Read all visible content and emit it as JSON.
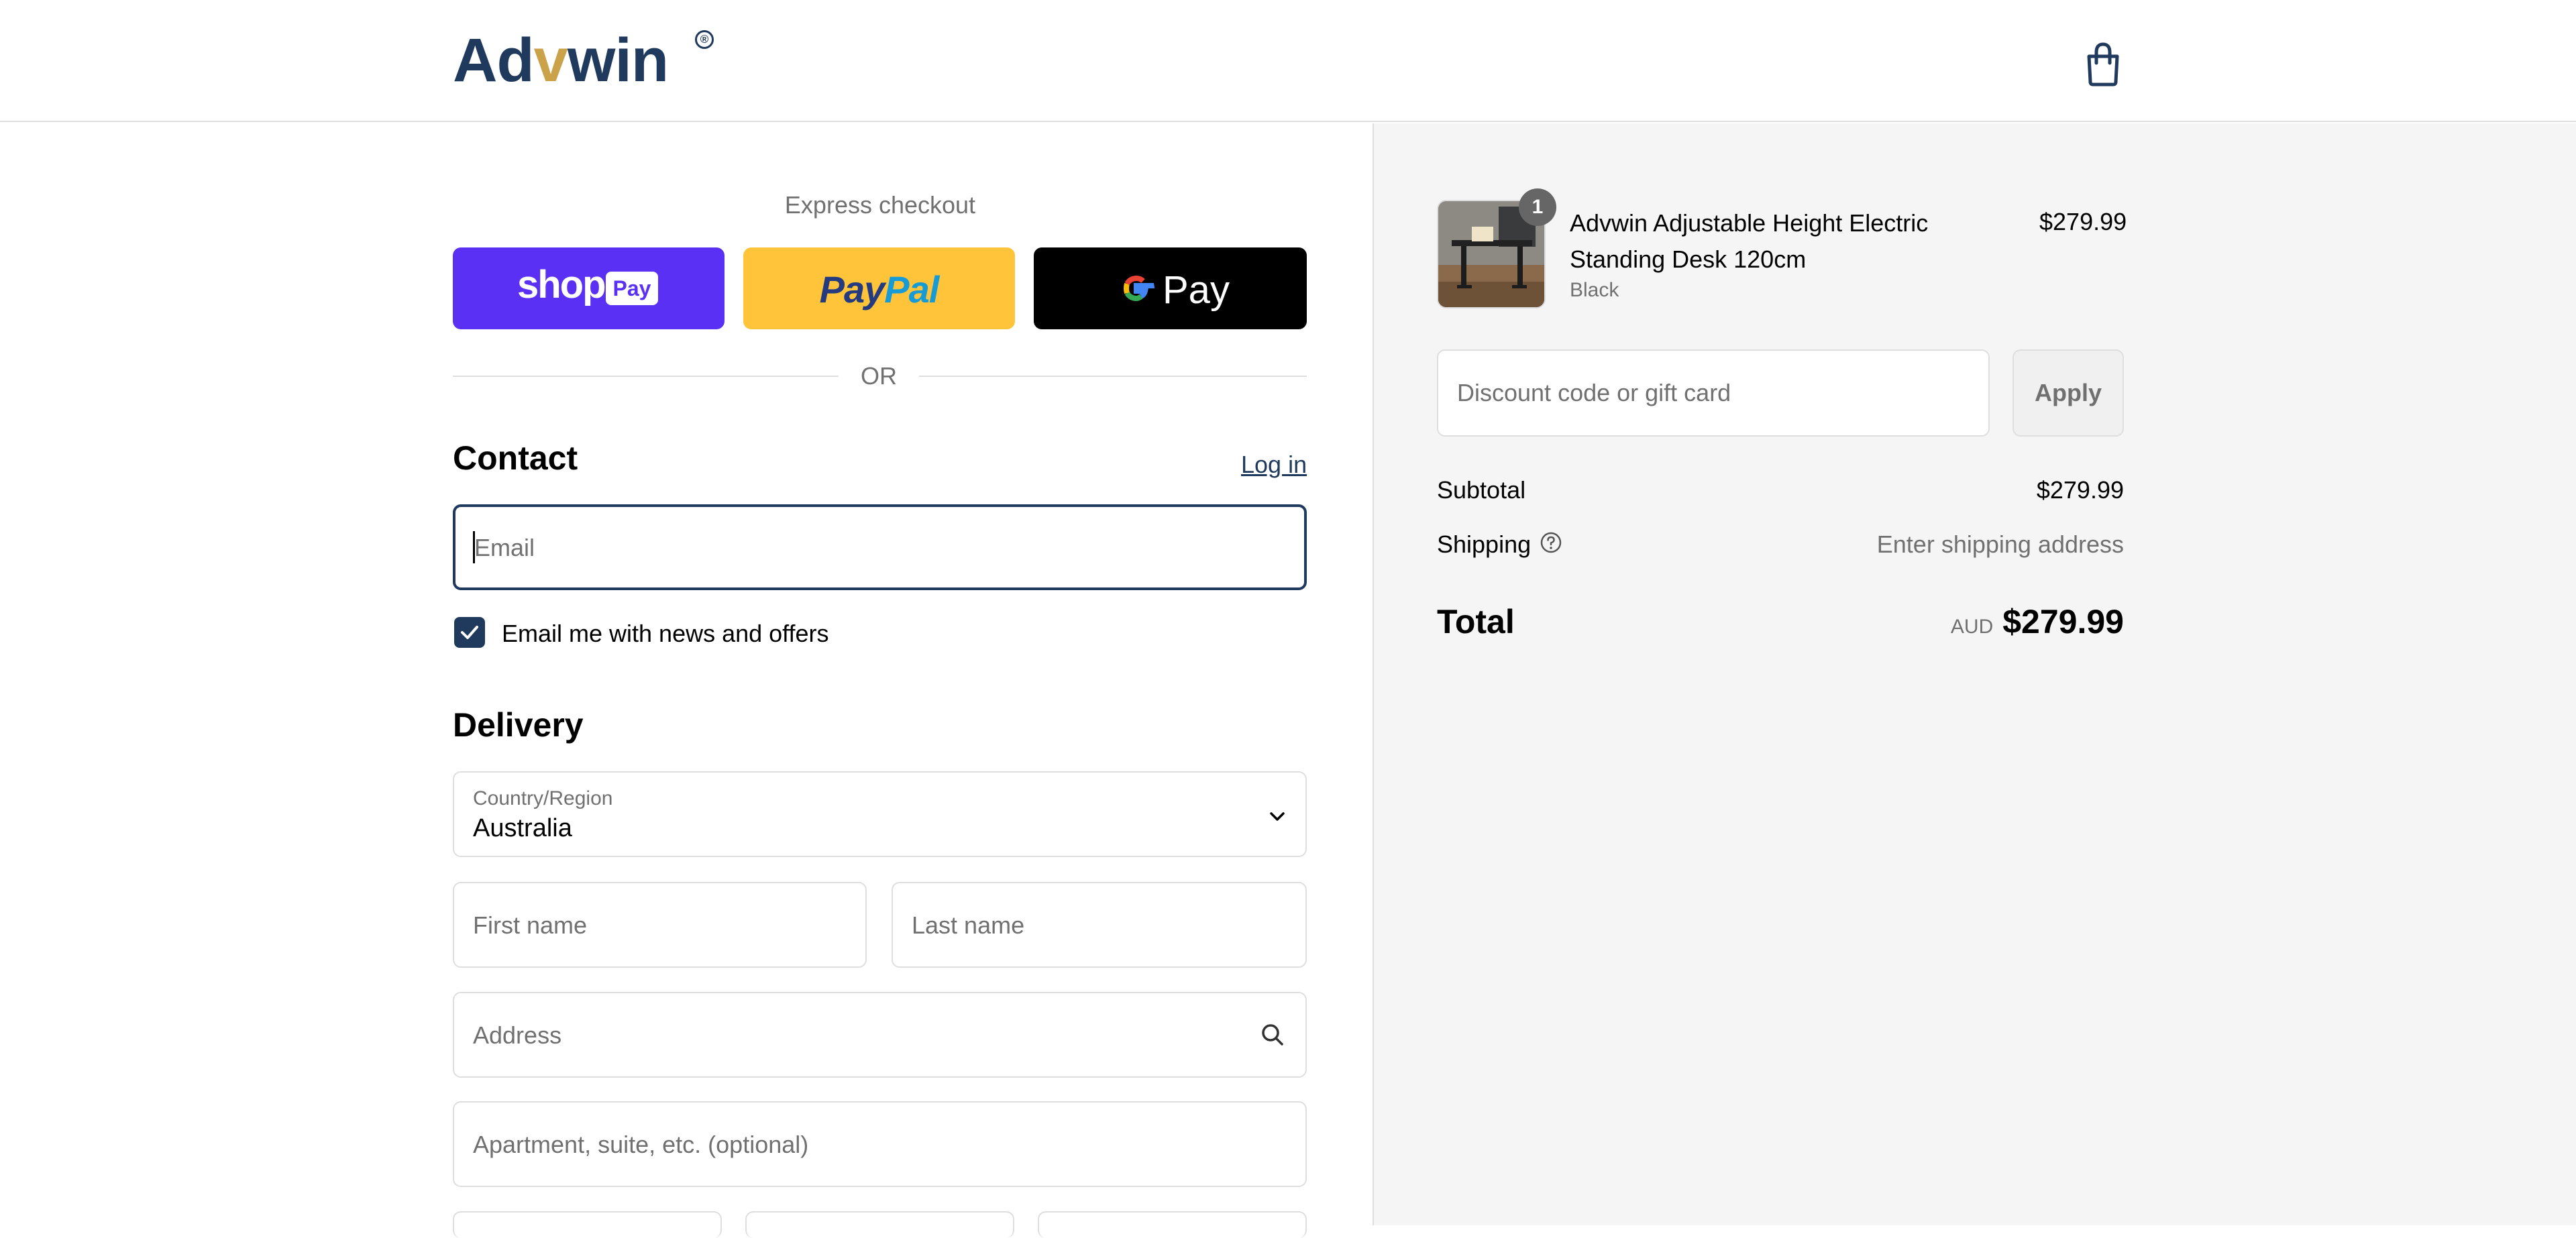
{
  "brand": {
    "logo_prefix": "Ad",
    "logo_v": "v",
    "logo_suffix": "win",
    "logo_reg": "®"
  },
  "colors": {
    "primary": "#1f3a5c",
    "shop_pay": "#5a31f4",
    "paypal": "#ffc439",
    "gpay": "#000000",
    "muted": "#707070"
  },
  "express": {
    "title": "Express checkout",
    "shop_pay": {
      "word": "shop",
      "badge": "Pay"
    },
    "paypal": {
      "part1": "Pay",
      "part2": "Pal"
    },
    "gpay": {
      "g": "G",
      "label": "Pay"
    },
    "or": "OR"
  },
  "contact": {
    "heading": "Contact",
    "login": "Log in",
    "email_placeholder": "Email",
    "newsletter_label": "Email me with news and offers",
    "newsletter_checked": true
  },
  "delivery": {
    "heading": "Delivery",
    "country_label": "Country/Region",
    "country_value": "Australia",
    "first_name_placeholder": "First name",
    "last_name_placeholder": "Last name",
    "address_placeholder": "Address",
    "apartment_placeholder": "Apartment, suite, etc. (optional)"
  },
  "order": {
    "item": {
      "quantity": "1",
      "name_line1": "Advwin Adjustable Height Electric",
      "name_line2": "Standing Desk 120cm",
      "variant": "Black",
      "price": "$279.99"
    },
    "discount_placeholder": "Discount code or gift card",
    "apply": "Apply",
    "subtotal_label": "Subtotal",
    "subtotal_value": "$279.99",
    "shipping_label": "Shipping",
    "shipping_value": "Enter shipping address",
    "total_label": "Total",
    "currency": "AUD",
    "total_value": "$279.99"
  },
  "icons": [
    "bag-icon",
    "check-icon",
    "chevron-down-icon",
    "search-icon",
    "help-icon",
    "google-g-icon"
  ]
}
